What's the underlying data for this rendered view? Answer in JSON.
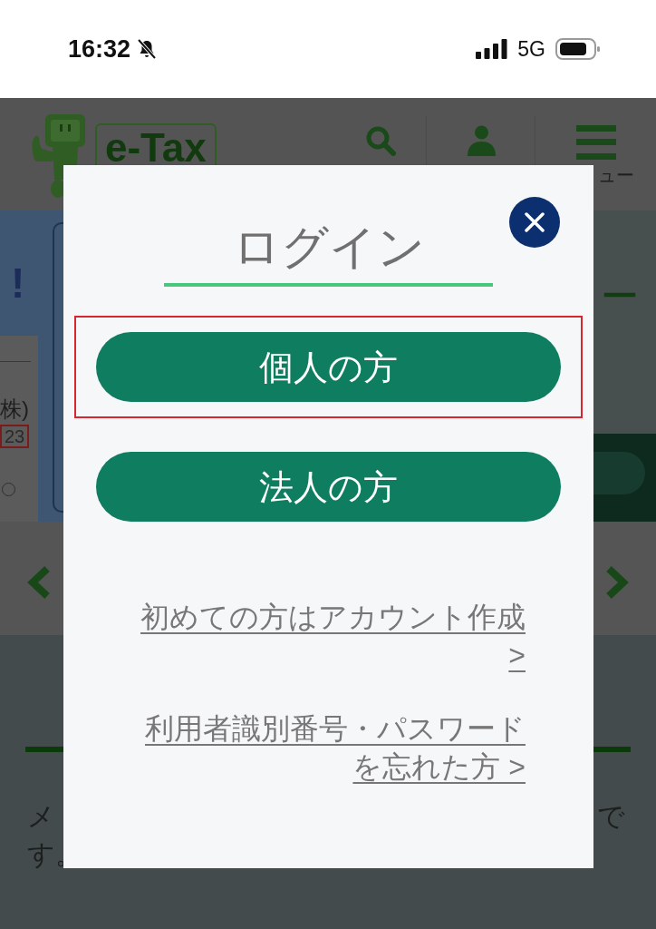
{
  "status_bar": {
    "time": "16:32",
    "network": "5G"
  },
  "header": {
    "logo": "e-Tax",
    "menu_label": "ュー"
  },
  "banner": {
    "headline": "!",
    "card_name": "株)",
    "card_code": "23",
    "side_text": "ー"
  },
  "section": {
    "line_1_start": "メ",
    "line_1_end": "で",
    "line_2": "す。"
  },
  "login_dialog": {
    "title": "ログイン",
    "buttons": [
      {
        "label": "個人の方",
        "highlighted": true
      },
      {
        "label": "法人の方",
        "highlighted": false
      }
    ],
    "links": [
      "初めての方はアカウント作成 >",
      "利用者識別番号・パスワードを忘れた方 >"
    ]
  }
}
